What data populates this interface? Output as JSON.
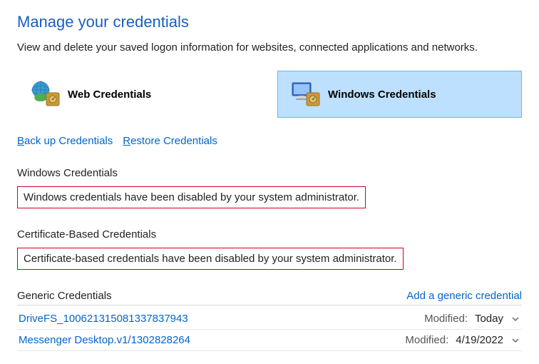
{
  "header": {
    "title": "Manage your credentials",
    "subtitle": "View and delete your saved logon information for websites, connected applications and networks."
  },
  "tabs": {
    "web": {
      "label": "Web Credentials"
    },
    "windows": {
      "label": "Windows Credentials"
    }
  },
  "links": {
    "backup": {
      "u": "B",
      "rest": "ack up Credentials"
    },
    "restore": {
      "u": "R",
      "rest": "estore Credentials"
    }
  },
  "sections": {
    "windows": {
      "title": "Windows Credentials",
      "message": "Windows credentials have been disabled by your system administrator."
    },
    "cert": {
      "title": "Certificate-Based Credentials",
      "message": "Certificate-based credentials have been disabled by your system administrator."
    },
    "generic": {
      "title": "Generic Credentials",
      "add_label": "Add a generic credential",
      "modified_label": "Modified:",
      "items": [
        {
          "name": "DriveFS_100621315081337837943",
          "modified": "Today"
        },
        {
          "name": "Messenger Desktop.v1/1302828264",
          "modified": "4/19/2022"
        }
      ]
    }
  }
}
